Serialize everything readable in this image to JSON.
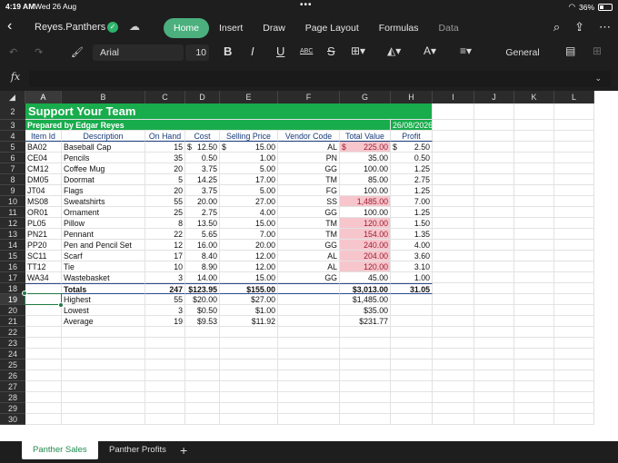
{
  "status": {
    "time": "4:19 AM",
    "date": "Wed 26 Aug",
    "battery": "36%"
  },
  "app": {
    "doc_name": "Reyes.Panthers",
    "tabs": [
      "Home",
      "Insert",
      "Draw",
      "Page Layout",
      "Formulas",
      "Data"
    ],
    "active_tab": "Home"
  },
  "toolbar": {
    "font": "Arial",
    "size": "10",
    "bold": "B",
    "italic": "I",
    "underline": "U",
    "abc": "ABC",
    "strike": "S",
    "number_format": "General"
  },
  "formula": {
    "fx": "fx",
    "value": ""
  },
  "columns": [
    "A",
    "B",
    "C",
    "D",
    "E",
    "F",
    "G",
    "H",
    "I",
    "J",
    "K",
    "L"
  ],
  "rows": [
    "2",
    "3",
    "4",
    "5",
    "6",
    "7",
    "8",
    "9",
    "10",
    "11",
    "12",
    "13",
    "14",
    "15",
    "16",
    "17",
    "18",
    "19",
    "20",
    "21",
    "22",
    "23",
    "24",
    "25",
    "26",
    "27",
    "28",
    "29",
    "30"
  ],
  "sheet": {
    "title": "Support Your Team",
    "subtitle": "Prepared by Edgar Reyes",
    "date": "26/08/2026",
    "headers": [
      "Item Id",
      "Description",
      "On Hand",
      "Cost",
      "Selling Price",
      "Vendor Code",
      "Total Value",
      "Profit"
    ],
    "items": [
      {
        "id": "BA02",
        "desc": "Baseball Cap",
        "onhand": "15",
        "cost_sym": "$",
        "cost": "12.50",
        "sell_sym": "$",
        "sell": "15.00",
        "vendor": "AL",
        "tv_sym": "$",
        "tv": "225.00",
        "pr_sym": "$",
        "profit": "2.50",
        "hl": true
      },
      {
        "id": "CE04",
        "desc": "Pencils",
        "onhand": "35",
        "cost": "0.50",
        "sell": "1.00",
        "vendor": "PN",
        "tv": "35.00",
        "profit": "0.50",
        "hl": false
      },
      {
        "id": "CM12",
        "desc": "Coffee Mug",
        "onhand": "20",
        "cost": "3.75",
        "sell": "5.00",
        "vendor": "GG",
        "tv": "100.00",
        "profit": "1.25",
        "hl": false
      },
      {
        "id": "DM05",
        "desc": "Doormat",
        "onhand": "5",
        "cost": "14.25",
        "sell": "17.00",
        "vendor": "TM",
        "tv": "85.00",
        "profit": "2.75",
        "hl": false
      },
      {
        "id": "JT04",
        "desc": "Flags",
        "onhand": "20",
        "cost": "3.75",
        "sell": "5.00",
        "vendor": "FG",
        "tv": "100.00",
        "profit": "1.25",
        "hl": false
      },
      {
        "id": "MS08",
        "desc": "Sweatshirts",
        "onhand": "55",
        "cost": "20.00",
        "sell": "27.00",
        "vendor": "SS",
        "tv": "1,485.00",
        "profit": "7.00",
        "hl": true
      },
      {
        "id": "OR01",
        "desc": "Ornament",
        "onhand": "25",
        "cost": "2.75",
        "sell": "4.00",
        "vendor": "GG",
        "tv": "100.00",
        "profit": "1.25",
        "hl": false
      },
      {
        "id": "PL05",
        "desc": "Pillow",
        "onhand": "8",
        "cost": "13.50",
        "sell": "15.00",
        "vendor": "TM",
        "tv": "120.00",
        "profit": "1.50",
        "hl": true
      },
      {
        "id": "PN21",
        "desc": "Pennant",
        "onhand": "22",
        "cost": "5.65",
        "sell": "7.00",
        "vendor": "TM",
        "tv": "154.00",
        "profit": "1.35",
        "hl": true
      },
      {
        "id": "PP20",
        "desc": "Pen and Pencil Set",
        "onhand": "12",
        "cost": "16.00",
        "sell": "20.00",
        "vendor": "GG",
        "tv": "240.00",
        "profit": "4.00",
        "hl": true
      },
      {
        "id": "SC11",
        "desc": "Scarf",
        "onhand": "17",
        "cost": "8.40",
        "sell": "12.00",
        "vendor": "AL",
        "tv": "204.00",
        "profit": "3.60",
        "hl": true
      },
      {
        "id": "TT12",
        "desc": "Tie",
        "onhand": "10",
        "cost": "8.90",
        "sell": "12.00",
        "vendor": "AL",
        "tv": "120.00",
        "profit": "3.10",
        "hl": true
      },
      {
        "id": "WA34",
        "desc": "Wastebasket",
        "onhand": "3",
        "cost": "14.00",
        "sell": "15.00",
        "vendor": "GG",
        "tv": "45.00",
        "profit": "1.00",
        "hl": false
      }
    ],
    "totals": {
      "label": "Totals",
      "onhand": "247",
      "cost": "$123.95",
      "sell": "$155.00",
      "tv": "$3,013.00",
      "profit": "31.05"
    },
    "stats": [
      {
        "label": "Highest",
        "onhand": "55",
        "cost": "$20.00",
        "sell": "$27.00",
        "tv": "$1,485.00"
      },
      {
        "label": "Lowest",
        "onhand": "3",
        "cost": "$0.50",
        "sell": "$1.00",
        "tv": "$35.00"
      },
      {
        "label": "Average",
        "onhand": "19",
        "cost": "$9.53",
        "sell": "$11.92",
        "tv": "$231.77"
      }
    ]
  },
  "sheet_tabs": [
    "Panther Sales",
    "Panther Profits"
  ],
  "active_sheet": "Panther Sales",
  "colors": {
    "accent": "#4bb07e",
    "banner": "#18ac4c",
    "highlight": "#f7c6cd",
    "header_text": "#163a78"
  }
}
